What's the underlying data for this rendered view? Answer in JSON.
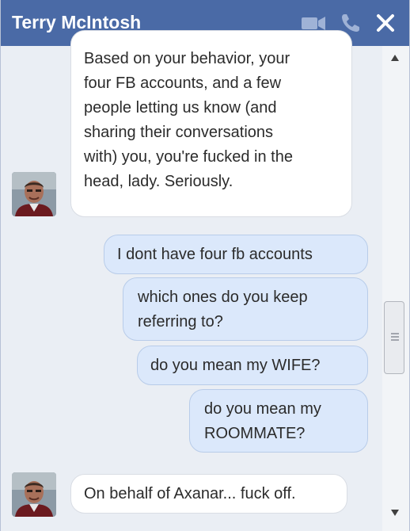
{
  "header": {
    "contact_name": "Terry McIntosh",
    "icons": [
      "video-call-icon",
      "phone-call-icon",
      "close-icon"
    ],
    "bg_color": "#4a6aa6"
  },
  "messages": [
    {
      "direction": "incoming",
      "lines": [
        "Based on your behavior, your",
        "four FB accounts, and a few",
        "people letting us know (and",
        "sharing their conversations",
        "with) you, you're fucked in the",
        "head, lady.  Seriously."
      ]
    },
    {
      "direction": "outgoing",
      "lines": [
        "I dont have four fb accounts"
      ]
    },
    {
      "direction": "outgoing",
      "lines": [
        "which ones do you keep",
        "referring to?"
      ]
    },
    {
      "direction": "outgoing",
      "lines": [
        "do you mean my WIFE?"
      ]
    },
    {
      "direction": "outgoing",
      "lines": [
        "do you mean my",
        "ROOMMATE?"
      ]
    },
    {
      "direction": "incoming",
      "lines": [
        "On behalf of Axanar... fuck off."
      ]
    }
  ],
  "colors": {
    "incoming_bubble": "#ffffff",
    "outgoing_bubble": "#dbe8fb",
    "chat_background": "#eaeef4"
  }
}
